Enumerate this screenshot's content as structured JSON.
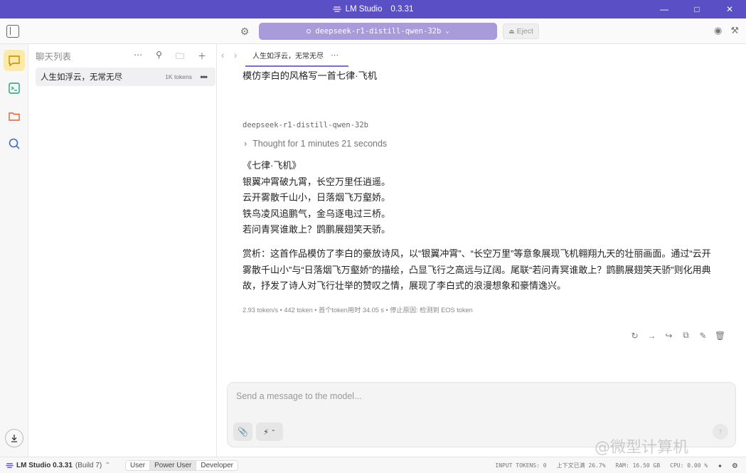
{
  "window": {
    "app_name": "LM Studio",
    "version": "0.3.31"
  },
  "toolbar": {
    "model_name": "deepseek-r1-distill-qwen-32b",
    "eject_label": "Eject"
  },
  "chatlist": {
    "title": "聊天列表",
    "items": [
      {
        "label": "人生如浮云，无常无尽",
        "tokens": "1K tokens"
      }
    ]
  },
  "tab": {
    "label": "人生如浮云，无常无尽"
  },
  "conversation": {
    "user_message": "模仿李白的风格写一首七律·飞机",
    "model_name": "deepseek-r1-distill-qwen-32b",
    "thought_label": "Thought for 1 minutes 21 seconds",
    "poem_lines": [
      "《七律·飞机》",
      "银翼冲霄破九霄，长空万里任逍遥。",
      "云开雾散千山小，日落烟飞万壑娇。",
      "铁鸟凌风追鹏气，金乌逐电过三桥。",
      "若问青冥谁敢上？鹍鹏展翅笑天骄。"
    ],
    "commentary": "赏析：这首作品模仿了李白的豪放诗风，以“银翼冲霄”、“长空万里”等意象展现飞机翱翔九天的壮丽画面。通过“云开雾散千山小”与“日落烟飞万壑娇”的描绘，凸显飞行之高远与辽阔。尾联“若问青冥谁敢上？鹍鹏展翅笑天骄”则化用典故，抒发了诗人对飞行壮举的赞叹之情，展现了李白式的浪漫想象和豪情逸兴。",
    "stats": "2.93 token/s • 442 token • 首个token用时 34.05 s • 停止原因: 检测到 EOS token"
  },
  "composer": {
    "placeholder": "Send a message to the model..."
  },
  "watermark": "@微型计算机",
  "statusbar": {
    "app_name": "LM Studio 0.3.31",
    "build": "(Build 7)",
    "modes": [
      "User",
      "Power User",
      "Developer"
    ],
    "selected_mode": "Power User",
    "input_tokens": "INPUT TOKENS:  0",
    "context": "上下文已满 26.7%",
    "ram": "RAM: 16.50 GB",
    "cpu": "CPU: 0.00 %"
  }
}
